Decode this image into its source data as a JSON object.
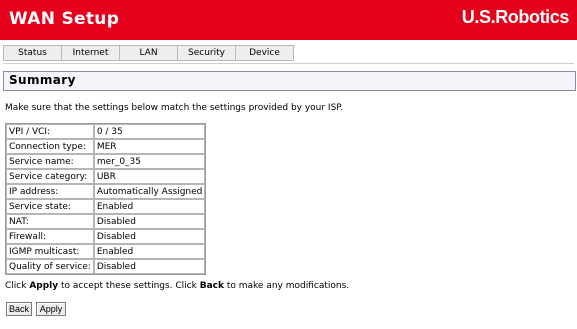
{
  "header": {
    "title": "WAN Setup",
    "logo": "U.S.Robotics",
    "background_color": "#e5001b"
  },
  "nav": {
    "tabs": [
      "Status",
      "Internet",
      "LAN",
      "Security",
      "Device"
    ]
  },
  "section": {
    "title": "Summary"
  },
  "intro_text": "Make sure that the settings below match the settings provided by your ISP.",
  "settings": [
    {
      "label": "VPI / VCI:",
      "value": "0 / 35"
    },
    {
      "label": "Connection type:",
      "value": "MER"
    },
    {
      "label": "Service name:",
      "value": "mer_0_35"
    },
    {
      "label": "Service category:",
      "value": "UBR"
    },
    {
      "label": "IP address:",
      "value": "Automatically Assigned"
    },
    {
      "label": "Service state:",
      "value": "Enabled"
    },
    {
      "label": "NAT:",
      "value": "Disabled"
    },
    {
      "label": "Firewall:",
      "value": "Disabled"
    },
    {
      "label": "IGMP multicast:",
      "value": "Enabled"
    },
    {
      "label": "Quality of service:",
      "value": "Disabled"
    }
  ],
  "apply_note": {
    "part1": "Click ",
    "apply_word": "Apply",
    "part2": " to accept these settings. Click ",
    "back_word": "Back",
    "part3": " to make any modifications."
  },
  "buttons": {
    "back_label": "Back",
    "apply_label": "Apply"
  }
}
